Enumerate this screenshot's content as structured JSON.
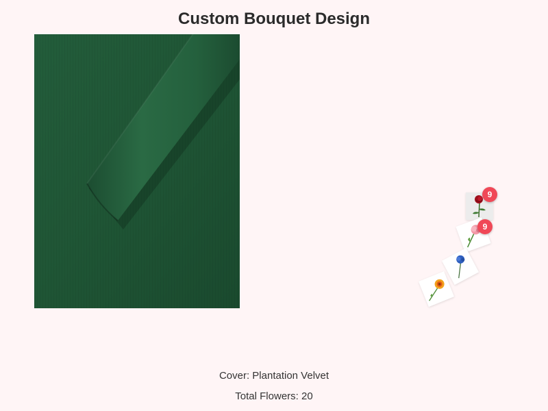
{
  "page": {
    "title": "Custom Bouquet Design"
  },
  "cover": {
    "image_icon": "green-velvet-roll-image",
    "label": "Cover: Plantation Velvet"
  },
  "bouquet": {
    "flowers": [
      {
        "icon": "red-rose-icon",
        "count": "9"
      },
      {
        "icon": "pink-carnation-icon",
        "count": "9"
      },
      {
        "icon": "blue-flower-icon"
      },
      {
        "icon": "orange-gerbera-icon"
      }
    ]
  },
  "summary": {
    "total_label": "Total Flowers: 20"
  },
  "colors": {
    "background": "#fff5f6",
    "cover_green": "#1f5636",
    "badge": "#f04857",
    "title_text": "#2b2b2b"
  }
}
